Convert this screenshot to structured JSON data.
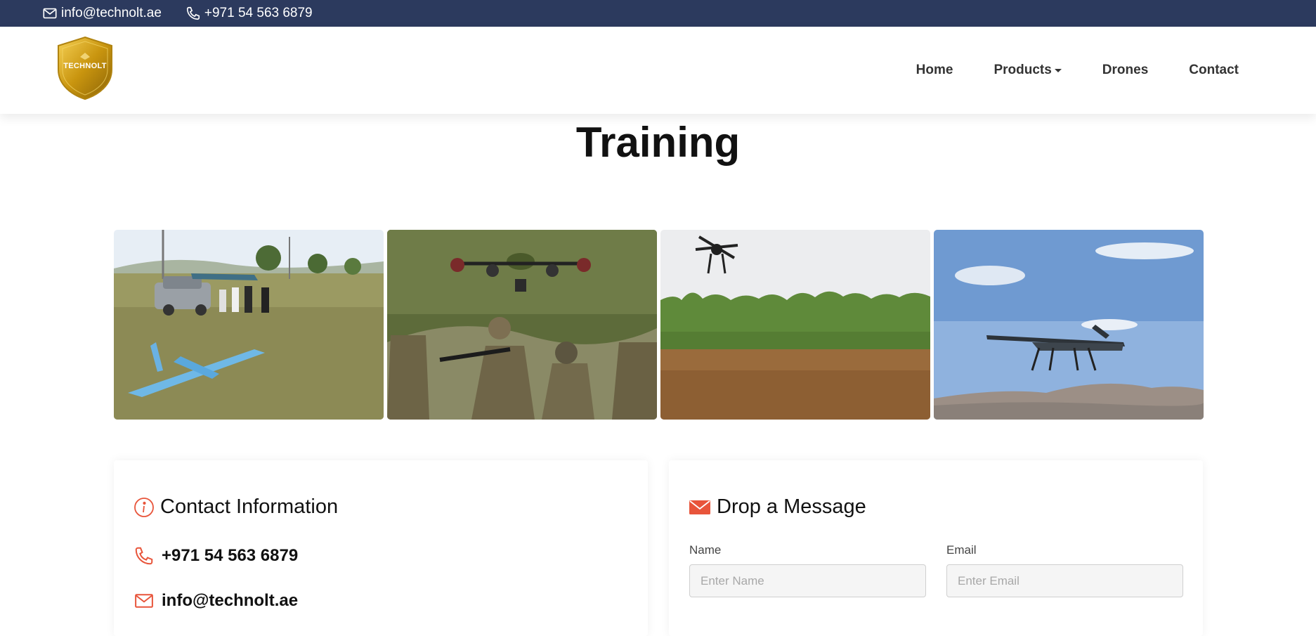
{
  "topbar": {
    "email": "info@technolt.ae",
    "phone": "+971 54 563 6879"
  },
  "brand": {
    "logo_text": "TECHNOLT",
    "logo_color": "#d4a017"
  },
  "nav": {
    "items": [
      {
        "label": "Home",
        "icon": null
      },
      {
        "label": "Products",
        "icon": "caret-down-icon"
      },
      {
        "label": "Drones",
        "icon": null
      },
      {
        "label": "Contact",
        "icon": null
      }
    ]
  },
  "page": {
    "title": "Training"
  },
  "gallery": {
    "images": [
      {
        "name": "field-team-vtol-drone"
      },
      {
        "name": "soldiers-with-hexacopter"
      },
      {
        "name": "quadcopter-over-forest"
      },
      {
        "name": "vtol-drone-over-hills"
      }
    ]
  },
  "contact_info": {
    "title": "Contact Information",
    "phone": "+971 54 563 6879",
    "email": "info@technolt.ae",
    "icon_color": "#e8553b"
  },
  "message_form": {
    "title": "Drop a Message",
    "name_label": "Name",
    "name_placeholder": "Enter Name",
    "email_label": "Email",
    "email_placeholder": "Enter Email"
  },
  "colors": {
    "topbar_bg": "#2c3a5e",
    "accent": "#e8553b"
  }
}
